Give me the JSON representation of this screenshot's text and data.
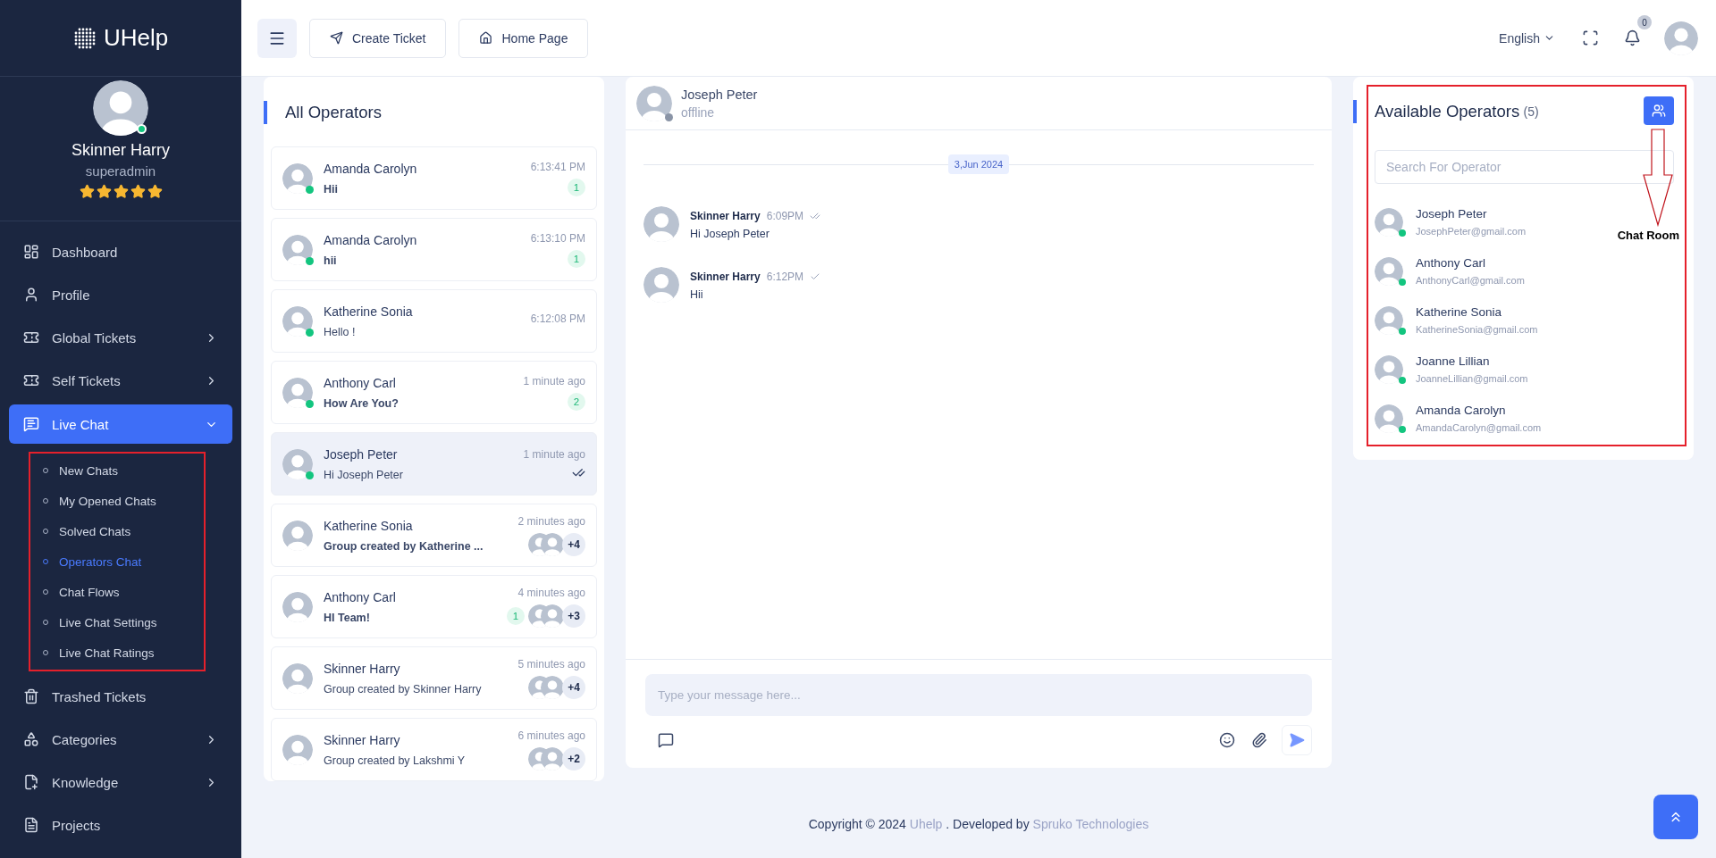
{
  "brand": "UHelp",
  "user": {
    "name": "Skinner Harry",
    "role": "superadmin",
    "online": true,
    "stars": 5
  },
  "nav": [
    {
      "label": "Dashboard",
      "expandable": false,
      "selected": false
    },
    {
      "label": "Profile",
      "expandable": false,
      "selected": false
    },
    {
      "label": "Global Tickets",
      "expandable": true,
      "selected": false,
      "expanded": false
    },
    {
      "label": "Self Tickets",
      "expandable": true,
      "selected": false,
      "expanded": false
    },
    {
      "label": "Live Chat",
      "expandable": true,
      "selected": true,
      "expanded": true,
      "children": [
        {
          "label": "New Chats",
          "selected": false
        },
        {
          "label": "My Opened Chats",
          "selected": false
        },
        {
          "label": "Solved Chats",
          "selected": false
        },
        {
          "label": "Operators Chat",
          "selected": true
        },
        {
          "label": "Chat Flows",
          "selected": false
        },
        {
          "label": "Live Chat Settings",
          "selected": false
        },
        {
          "label": "Live Chat Ratings",
          "selected": false
        }
      ]
    },
    {
      "label": "Trashed Tickets",
      "expandable": false,
      "selected": false
    },
    {
      "label": "Categories",
      "expandable": true,
      "selected": false,
      "expanded": false
    },
    {
      "label": "Knowledge",
      "expandable": true,
      "selected": false,
      "expanded": false
    },
    {
      "label": "Projects",
      "expandable": false,
      "selected": false
    }
  ],
  "header": {
    "buttons": [
      "Create Ticket",
      "Home Page"
    ],
    "language": "English",
    "notifications": "0"
  },
  "operators_panel": {
    "title": "All Operators",
    "chats": [
      {
        "name": "Amanda Carolyn",
        "time": "6:13:41 PM",
        "message": "Hii",
        "unread": true,
        "online": true,
        "count": "1",
        "selected": false
      },
      {
        "name": "Amanda Carolyn",
        "time": "6:13:10 PM",
        "message": "hii",
        "unread": true,
        "online": true,
        "count": "1",
        "selected": false
      },
      {
        "name": "Katherine Sonia",
        "time": "6:12:08 PM",
        "message": "Hello !",
        "unread": false,
        "online": true,
        "selected": false
      },
      {
        "name": "Anthony Carl",
        "time": "1 minute ago",
        "message": "How Are You?",
        "unread": true,
        "online": true,
        "count": "2",
        "selected": false
      },
      {
        "name": "Joseph Peter",
        "time": "1 minute ago",
        "message": "Hi Joseph Peter",
        "unread": false,
        "online": true,
        "seen": true,
        "selected": true
      },
      {
        "name": "Katherine Sonia",
        "time": "2 minutes ago",
        "message": "Group created by Katherine ...",
        "unread": true,
        "online": false,
        "group_more": "+4",
        "selected": false
      },
      {
        "name": "Anthony Carl",
        "time": "4 minutes ago",
        "message": "HI Team!",
        "unread": true,
        "online": false,
        "count": "1",
        "group_more": "+3",
        "selected": false
      },
      {
        "name": "Skinner Harry",
        "time": "5 minutes ago",
        "message": "Group created by Skinner Harry",
        "unread": false,
        "online": false,
        "group_more": "+4",
        "selected": false
      },
      {
        "name": "Skinner Harry",
        "time": "6 minutes ago",
        "message": "Group created by Lakshmi Y",
        "unread": false,
        "online": false,
        "group_more": "+2",
        "selected": false
      }
    ]
  },
  "chat": {
    "contact": {
      "name": "Joseph Peter",
      "status": "offline",
      "online": false
    },
    "date": "3,Jun 2024",
    "messages": [
      {
        "sender": "Skinner Harry",
        "time": "6:09PM",
        "read": true,
        "text": "Hi Joseph Peter"
      },
      {
        "sender": "Skinner Harry",
        "time": "6:12PM",
        "read": false,
        "text": "Hii"
      }
    ],
    "composer": {
      "placeholder": "Type your message here..."
    }
  },
  "available": {
    "title": "Available Operators",
    "count": "(5)",
    "search": {
      "placeholder": "Search For Operator"
    },
    "operators": [
      {
        "name": "Joseph Peter",
        "email": "JosephPeter@gmail.com",
        "online": true
      },
      {
        "name": "Anthony Carl",
        "email": "AnthonyCarl@gmail.com",
        "online": true
      },
      {
        "name": "Katherine Sonia",
        "email": "KatherineSonia@gmail.com",
        "online": true
      },
      {
        "name": "Joanne Lillian",
        "email": "JoanneLillian@gmail.com",
        "online": true
      },
      {
        "name": "Amanda Carolyn",
        "email": "AmandaCarolyn@gmail.com",
        "online": true
      }
    ]
  },
  "annotation": {
    "label": "Chat Room"
  },
  "footer": {
    "before": "Copyright © 2024",
    "brand_link": "Uhelp",
    "middle": ". Developed by",
    "company_link": "Spruko Technologies"
  }
}
